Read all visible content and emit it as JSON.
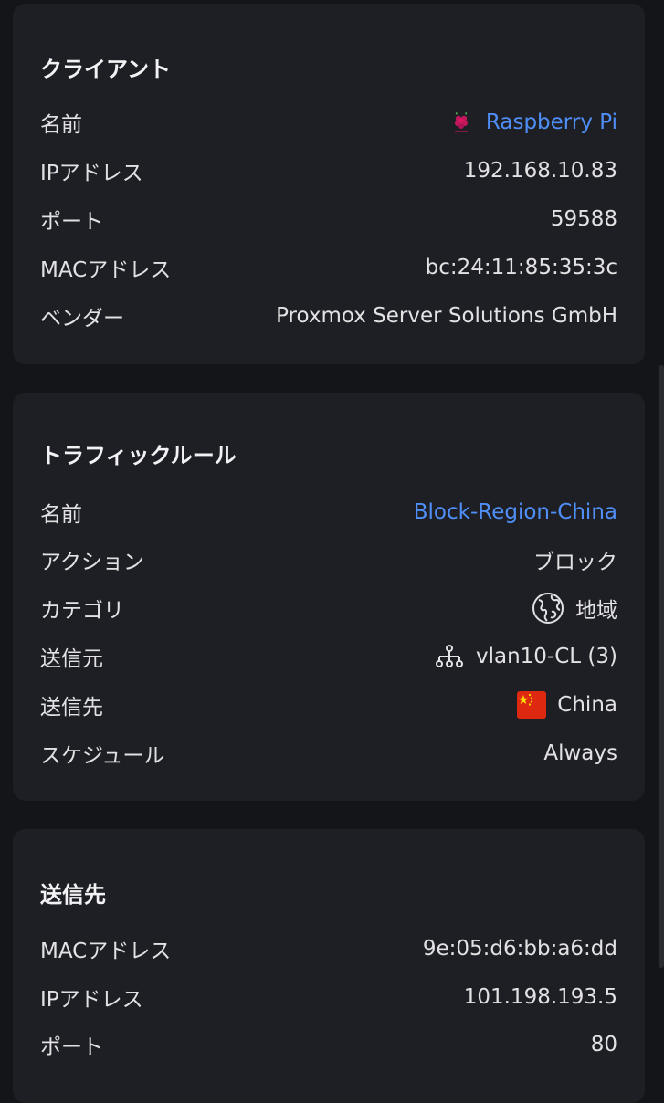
{
  "client": {
    "title": "クライアント",
    "rows": [
      {
        "label": "名前",
        "value": "Raspberry Pi"
      },
      {
        "label": "IPアドレス",
        "value": "192.168.10.83"
      },
      {
        "label": "ポート",
        "value": "59588"
      },
      {
        "label": "MACアドレス",
        "value": "bc:24:11:85:35:3c"
      },
      {
        "label": "ベンダー",
        "value": "Proxmox Server Solutions GmbH"
      }
    ],
    "name_icon": "raspberry-pi-logo"
  },
  "traffic_rule": {
    "title": "トラフィックルール",
    "rows": [
      {
        "label": "名前",
        "value": "Block-Region-China"
      },
      {
        "label": "アクション",
        "value": "ブロック"
      },
      {
        "label": "カテゴリ",
        "value": "地域",
        "icon": "globe-icon"
      },
      {
        "label": "送信元",
        "value": "vlan10-CL (3)",
        "icon": "network-icon"
      },
      {
        "label": "送信先",
        "value": "China",
        "icon": "china-flag-icon"
      },
      {
        "label": "スケジュール",
        "value": "Always"
      }
    ]
  },
  "destination": {
    "title": "送信先",
    "rows": [
      {
        "label": "MACアドレス",
        "value": "9e:05:d6:bb:a6:dd"
      },
      {
        "label": "IPアドレス",
        "value": "101.198.193.5"
      },
      {
        "label": "ポート",
        "value": "80"
      }
    ]
  },
  "colors": {
    "background": "#141518",
    "card": "#1e1f24",
    "link": "#4f8ff7",
    "text": "#e2e2e4"
  }
}
